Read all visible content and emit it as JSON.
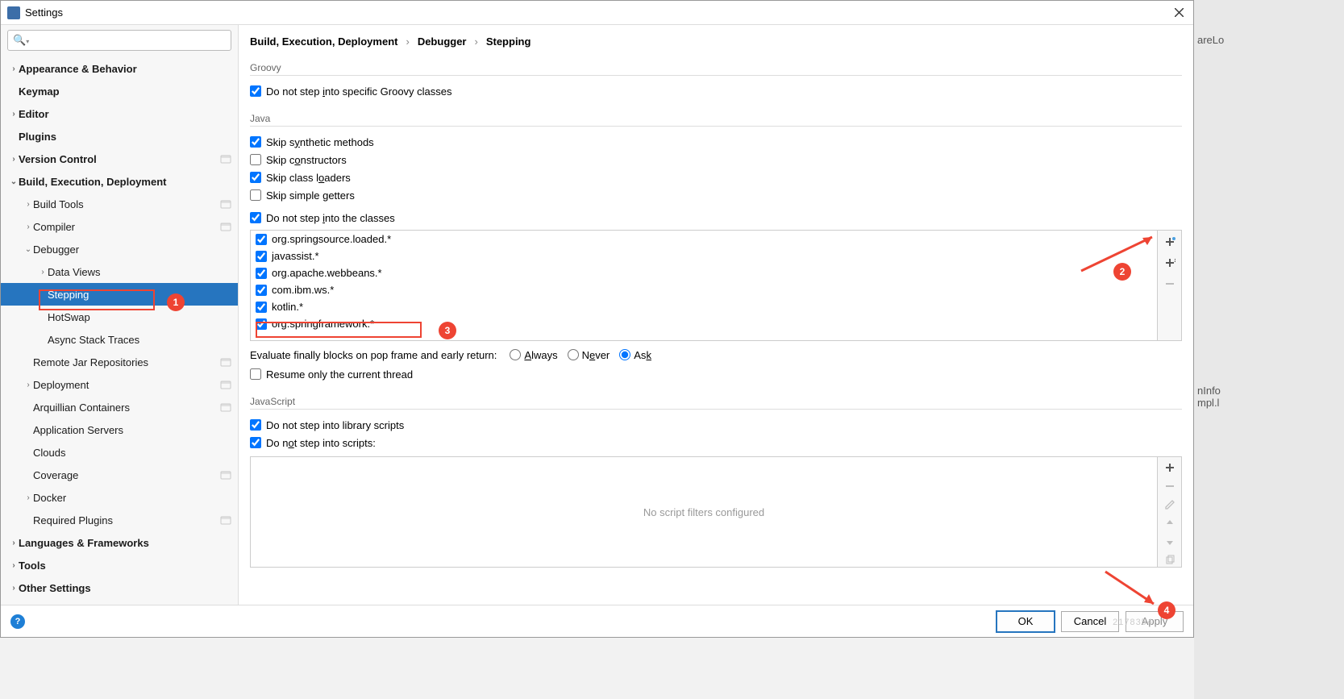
{
  "window": {
    "title": "Settings"
  },
  "search": {
    "placeholder": ""
  },
  "sidebar": {
    "items": [
      {
        "label": "Appearance & Behavior",
        "bold": true,
        "level": 0,
        "arrow": "›",
        "proj": false
      },
      {
        "label": "Keymap",
        "bold": true,
        "level": 0,
        "arrow": "",
        "proj": false
      },
      {
        "label": "Editor",
        "bold": true,
        "level": 0,
        "arrow": "›",
        "proj": false
      },
      {
        "label": "Plugins",
        "bold": true,
        "level": 0,
        "arrow": "",
        "proj": false
      },
      {
        "label": "Version Control",
        "bold": true,
        "level": 0,
        "arrow": "›",
        "proj": true
      },
      {
        "label": "Build, Execution, Deployment",
        "bold": true,
        "level": 0,
        "arrow": "⌄",
        "proj": false
      },
      {
        "label": "Build Tools",
        "bold": false,
        "level": 1,
        "arrow": "›",
        "proj": true
      },
      {
        "label": "Compiler",
        "bold": false,
        "level": 1,
        "arrow": "›",
        "proj": true
      },
      {
        "label": "Debugger",
        "bold": false,
        "level": 1,
        "arrow": "⌄",
        "proj": false
      },
      {
        "label": "Data Views",
        "bold": false,
        "level": 2,
        "arrow": "›",
        "proj": false
      },
      {
        "label": "Stepping",
        "bold": false,
        "level": 2,
        "arrow": "",
        "selected": true,
        "proj": false
      },
      {
        "label": "HotSwap",
        "bold": false,
        "level": 2,
        "arrow": "",
        "proj": false
      },
      {
        "label": "Async Stack Traces",
        "bold": false,
        "level": 2,
        "arrow": "",
        "proj": false
      },
      {
        "label": "Remote Jar Repositories",
        "bold": false,
        "level": 1,
        "arrow": "",
        "proj": true
      },
      {
        "label": "Deployment",
        "bold": false,
        "level": 1,
        "arrow": "›",
        "proj": true
      },
      {
        "label": "Arquillian Containers",
        "bold": false,
        "level": 1,
        "arrow": "",
        "proj": true
      },
      {
        "label": "Application Servers",
        "bold": false,
        "level": 1,
        "arrow": "",
        "proj": false
      },
      {
        "label": "Clouds",
        "bold": false,
        "level": 1,
        "arrow": "",
        "proj": false
      },
      {
        "label": "Coverage",
        "bold": false,
        "level": 1,
        "arrow": "",
        "proj": true
      },
      {
        "label": "Docker",
        "bold": false,
        "level": 1,
        "arrow": "›",
        "proj": false
      },
      {
        "label": "Required Plugins",
        "bold": false,
        "level": 1,
        "arrow": "",
        "proj": true
      },
      {
        "label": "Languages & Frameworks",
        "bold": true,
        "level": 0,
        "arrow": "›",
        "proj": false
      },
      {
        "label": "Tools",
        "bold": true,
        "level": 0,
        "arrow": "›",
        "proj": false
      },
      {
        "label": "Other Settings",
        "bold": true,
        "level": 0,
        "arrow": "›",
        "proj": false
      }
    ]
  },
  "breadcrumb": [
    "Build, Execution, Deployment",
    "Debugger",
    "Stepping"
  ],
  "groovy": {
    "title": "Groovy",
    "doNotStep": {
      "label": "Do not step into specific Groovy classes",
      "checked": true
    }
  },
  "java": {
    "title": "Java",
    "skipSynthetic": {
      "label": "Skip synthetic methods",
      "checked": true
    },
    "skipConstructors": {
      "label": "Skip constructors",
      "checked": false
    },
    "skipClassLoaders": {
      "label": "Skip class loaders",
      "checked": true
    },
    "skipSimpleGetters": {
      "label": "Skip simple getters",
      "checked": false
    },
    "doNotStepClasses": {
      "label": "Do not step into the classes",
      "checked": true
    },
    "classes": [
      {
        "label": "org.springsource.loaded.*",
        "checked": true
      },
      {
        "label": "javassist.*",
        "checked": true
      },
      {
        "label": "org.apache.webbeans.*",
        "checked": true
      },
      {
        "label": "com.ibm.ws.*",
        "checked": true
      },
      {
        "label": "kotlin.*",
        "checked": true
      },
      {
        "label": "org.springframework.*",
        "checked": true
      }
    ],
    "evalFinally": {
      "label": "Evaluate finally blocks on pop frame and early return:",
      "options": [
        "Always",
        "Never",
        "Ask"
      ],
      "selected": "Ask"
    },
    "resumeCurrent": {
      "label": "Resume only the current thread",
      "checked": false
    }
  },
  "javascript": {
    "title": "JavaScript",
    "doNotStepLib": {
      "label": "Do not step into library scripts",
      "checked": true
    },
    "doNotStepScripts": {
      "label": "Do not step into scripts:",
      "checked": true
    },
    "emptyMsg": "No script filters configured"
  },
  "footer": {
    "ok": "OK",
    "cancel": "Cancel",
    "apply": "Apply"
  },
  "behind": {
    "t1": "areLo",
    "t2": "nInfo",
    "t3": "mpl.l"
  },
  "watermark": "2178354"
}
